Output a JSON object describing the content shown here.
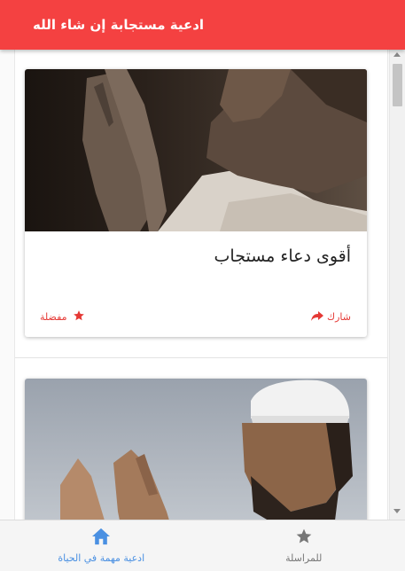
{
  "appbar": {
    "title": "ادعية مستجابة إن شاء الله"
  },
  "cards": [
    {
      "title": "أقوى دعاء مستجاب",
      "share_label": "شارك",
      "favorite_label": "مفضلة"
    },
    {
      "title": ""
    }
  ],
  "bottom_nav": {
    "items": [
      {
        "label": "ادعية مهمة في الحياة",
        "icon": "home-icon",
        "active": true
      },
      {
        "label": "للمراسلة",
        "icon": "star-icon",
        "active": false
      }
    ]
  },
  "colors": {
    "appbar": "#f44141",
    "accent_red": "#e53935",
    "nav_active": "#4a90e2",
    "nav_inactive": "#777777"
  }
}
